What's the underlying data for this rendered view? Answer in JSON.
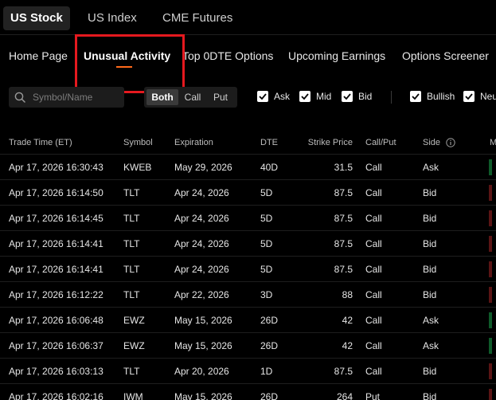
{
  "market_tabs": [
    "US Stock",
    "US Index",
    "CME Futures"
  ],
  "nav": [
    "Home Page",
    "Unusual Activity",
    "Top 0DTE Options",
    "Upcoming Earnings",
    "Options Screener"
  ],
  "filters": {
    "search_placeholder": "Symbol/Name",
    "segment": [
      "Both",
      "Call",
      "Put"
    ],
    "checkboxes": [
      "Ask",
      "Mid",
      "Bid",
      "Bullish",
      "Neu"
    ]
  },
  "table": {
    "headers": [
      "Trade Time (ET)",
      "Symbol",
      "Expiration",
      "DTE",
      "Strike Price",
      "Call/Put",
      "Side",
      "M"
    ],
    "rows": [
      [
        "Apr 17, 2026 16:30:43",
        "KWEB",
        "May 29, 2026",
        "40D",
        "31.5",
        "Call",
        "Ask"
      ],
      [
        "Apr 17, 2026 16:14:50",
        "TLT",
        "Apr 24, 2026",
        "5D",
        "87.5",
        "Call",
        "Bid"
      ],
      [
        "Apr 17, 2026 16:14:45",
        "TLT",
        "Apr 24, 2026",
        "5D",
        "87.5",
        "Call",
        "Bid"
      ],
      [
        "Apr 17, 2026 16:14:41",
        "TLT",
        "Apr 24, 2026",
        "5D",
        "87.5",
        "Call",
        "Bid"
      ],
      [
        "Apr 17, 2026 16:14:41",
        "TLT",
        "Apr 24, 2026",
        "5D",
        "87.5",
        "Call",
        "Bid"
      ],
      [
        "Apr 17, 2026 16:12:22",
        "TLT",
        "Apr 22, 2026",
        "3D",
        "88",
        "Call",
        "Bid"
      ],
      [
        "Apr 17, 2026 16:06:48",
        "EWZ",
        "May 15, 2026",
        "26D",
        "42",
        "Call",
        "Ask"
      ],
      [
        "Apr 17, 2026 16:06:37",
        "EWZ",
        "May 15, 2026",
        "26D",
        "42",
        "Call",
        "Ask"
      ],
      [
        "Apr 17, 2026 16:03:13",
        "TLT",
        "Apr 20, 2026",
        "1D",
        "87.5",
        "Call",
        "Bid"
      ],
      [
        "Apr 17, 2026 16:02:16",
        "IWM",
        "May 15, 2026",
        "26D",
        "264",
        "Put",
        "Bid"
      ]
    ]
  },
  "colors": {
    "accent": "#ff6a1a",
    "highlight": "#e5191f",
    "bullish": "#0f5a2a",
    "bearish": "#5a1414"
  }
}
